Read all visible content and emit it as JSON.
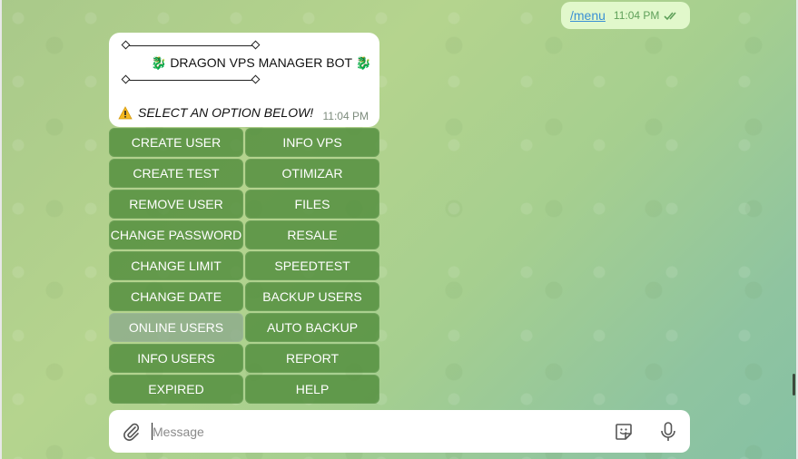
{
  "outgoing": {
    "text": "/menu",
    "time": "11:04 PM",
    "status_icon": "double-check-icon"
  },
  "bot_message": {
    "title": "🐉 DRAGON VPS MANAGER BOT 🐉",
    "prompt": "SELECT AN OPTION BELOW!",
    "warning_icon": "warning-icon",
    "time": "11:04 PM"
  },
  "keyboard": {
    "rows": [
      [
        "CREATE USER",
        "INFO VPS"
      ],
      [
        "CREATE TEST",
        "OTIMIZAR"
      ],
      [
        "REMOVE USER",
        "FILES"
      ],
      [
        "CHANGE PASSWORD",
        "RESALE"
      ],
      [
        "CHANGE LIMIT",
        "SPEEDTEST"
      ],
      [
        "CHANGE DATE",
        "BACKUP USERS"
      ],
      [
        "ONLINE USERS",
        "AUTO BACKUP"
      ],
      [
        "INFO USERS",
        "REPORT"
      ],
      [
        "EXPIRED",
        "HELP"
      ]
    ]
  },
  "composer": {
    "placeholder": "Message",
    "value": ""
  },
  "colors": {
    "button_bg": "#5c9a48",
    "button_hover": "#8caa8c",
    "outgoing_bubble": "#e1f8cb",
    "link": "#3a90d4"
  }
}
